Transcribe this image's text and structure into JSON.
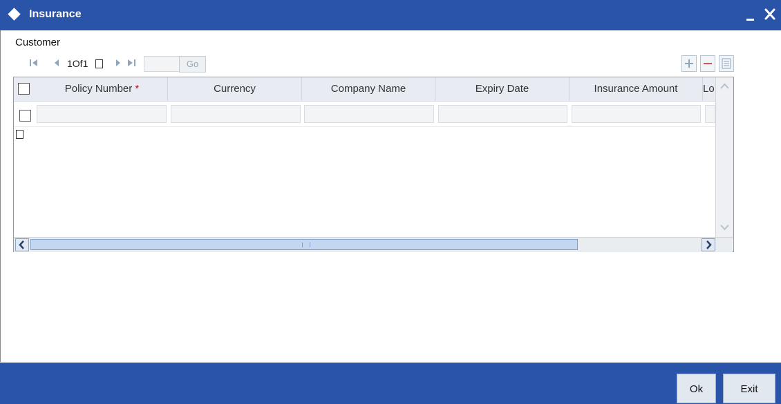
{
  "window": {
    "title": "Insurance"
  },
  "section": {
    "label": "Customer"
  },
  "pager": {
    "text": "1Of1"
  },
  "grid": {
    "columns": [
      "Policy Number",
      "Currency",
      "Company Name",
      "Expiry Date",
      "Insurance Amount",
      "Lo"
    ],
    "required_marker": "*"
  },
  "footer": {
    "ok_label": "Ok",
    "exit_label": "Exit"
  },
  "colors": {
    "title_bar": "#2a54a8",
    "footer_bar": "#2a54a8",
    "header_bg": "#e8ecf2"
  },
  "icons": [
    "diamond-icon",
    "minimize-icon",
    "close-icon",
    "first-page-icon",
    "prev-page-icon",
    "next-page-icon",
    "last-page-icon",
    "add-row-icon",
    "delete-row-icon",
    "single-view-icon"
  ]
}
